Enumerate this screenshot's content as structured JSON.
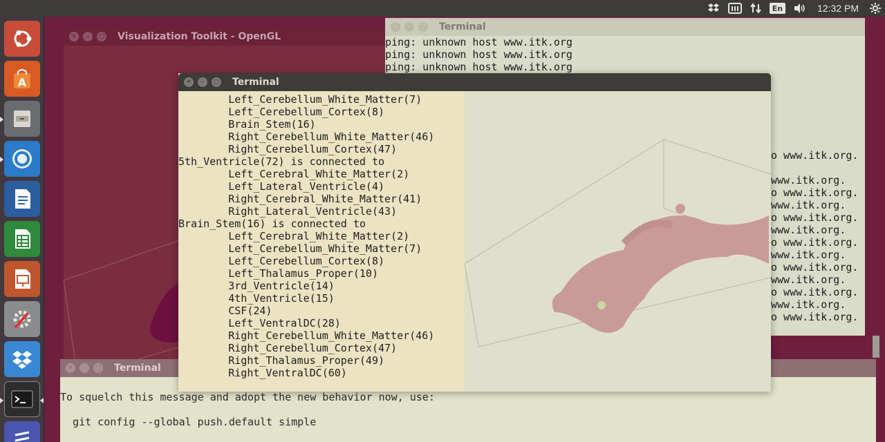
{
  "panel": {
    "lang": "En",
    "clock": "12:32 PM"
  },
  "launcher": [
    {
      "name": "ubuntu-dash-icon"
    },
    {
      "name": "software-center-icon"
    },
    {
      "name": "files-icon"
    },
    {
      "name": "chromium-icon"
    },
    {
      "name": "writer-icon"
    },
    {
      "name": "calc-icon"
    },
    {
      "name": "impress-icon"
    },
    {
      "name": "system-settings-icon"
    },
    {
      "name": "dropbox-icon"
    },
    {
      "name": "terminal-icon"
    },
    {
      "name": "more-app-icon"
    }
  ],
  "vtk_window": {
    "title": "Visualization Toolkit - OpenGL"
  },
  "right_terminal": {
    "title": "Terminal",
    "lines": [
      "ping: unknown host www.itk.org",
      "ping: unknown host www.itk.org",
      "ping: unknown host www.itk.org"
    ],
    "tail_lines": [
      "o www.itk.org.",
      "",
      "www.itk.org.",
      "o www.itk.org.",
      "www.itk.org.",
      "o www.itk.org.",
      "www.itk.org.",
      "o www.itk.org.",
      "www.itk.org.",
      "o www.itk.org.",
      "www.itk.org.",
      "o www.itk.org.",
      "www.itk.org.",
      "o www.itk.org."
    ]
  },
  "main_terminal": {
    "title": "Terminal",
    "lines": [
      "        Left_Cerebellum_White_Matter(7)",
      "        Left_Cerebellum_Cortex(8)",
      "        Brain_Stem(16)",
      "        Right_Cerebellum_White_Matter(46)",
      "        Right_Cerebellum_Cortex(47)",
      "5th_Ventricle(72) is connected to",
      "        Left_Cerebral_White_Matter(2)",
      "        Left_Lateral_Ventricle(4)",
      "        Right_Cerebral_White_Matter(41)",
      "        Right_Lateral_Ventricle(43)",
      "Brain_Stem(16) is connected to",
      "        Left_Cerebral_White_Matter(2)",
      "        Left_Cerebellum_White_Matter(7)",
      "        Left_Cerebellum_Cortex(8)",
      "        Left_Thalamus_Proper(10)",
      "        3rd_Ventricle(14)",
      "        4th_Ventricle(15)",
      "        CSF(24)",
      "        Left_VentralDC(28)",
      "        Right_Cerebellum_White_Matter(46)",
      "        Right_Cerebellum_Cortex(47)",
      "        Right_Thalamus_Proper(49)",
      "        Right_VentralDC(60)"
    ]
  },
  "bottom_terminal": {
    "title": "Terminal",
    "lines": [
      "To squelch this message and adopt the new behavior now, use:",
      "",
      "  git config --global push.default simple"
    ]
  }
}
